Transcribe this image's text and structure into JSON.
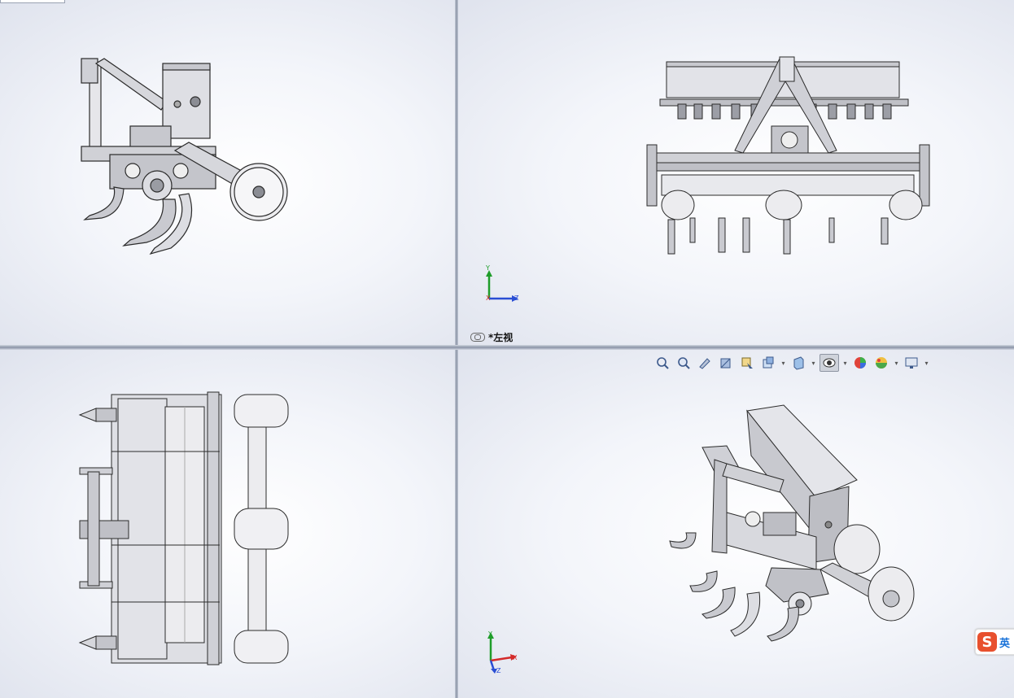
{
  "viewports": {
    "top_right": {
      "view_label": "*左视",
      "triad": {
        "axis_up": "Y",
        "axis_right": "Z",
        "axis_origin": "X"
      }
    },
    "bottom_right": {
      "triad": {
        "axis_up": "Y",
        "axis_right": "X",
        "axis_origin": "Z"
      },
      "toolbar": [
        {
          "name": "zoom-to-fit-icon"
        },
        {
          "name": "zoom-to-area-icon"
        },
        {
          "name": "previous-view-icon"
        },
        {
          "name": "section-view-icon"
        },
        {
          "name": "dynamic-annotation-icon"
        },
        {
          "name": "view-orientation-icon"
        },
        {
          "name": "display-style-icon"
        },
        {
          "name": "hide-show-items-icon"
        },
        {
          "name": "edit-appearance-icon"
        },
        {
          "name": "apply-scene-icon"
        },
        {
          "name": "view-settings-icon"
        }
      ]
    }
  },
  "ime": {
    "label": "英",
    "logo": "S"
  },
  "colors": {
    "axis_x": "#d42a2a",
    "axis_y": "#1f9d2a",
    "axis_z": "#2a4ed4",
    "outline": "#2b2b2b",
    "metal": "#c9cacf"
  }
}
